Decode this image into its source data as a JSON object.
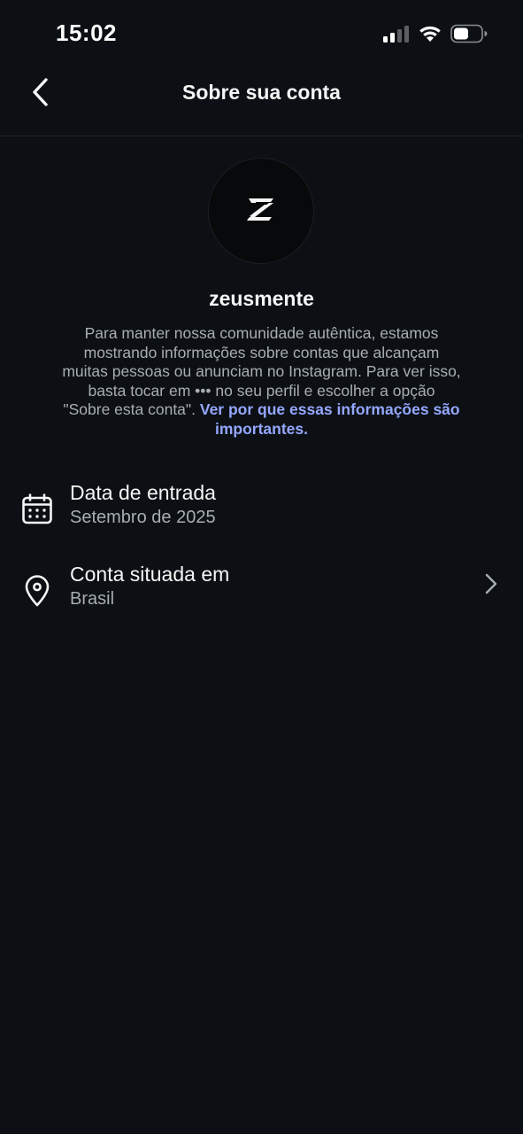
{
  "status_bar": {
    "time": "15:02",
    "icons": [
      "cellular-signal-icon",
      "wifi-icon",
      "battery-icon"
    ]
  },
  "header": {
    "title": "Sobre sua conta",
    "back_icon": "chevron-left-icon"
  },
  "profile": {
    "username": "zeusmente",
    "avatar_glyph": "Z"
  },
  "description": {
    "text_lines": [
      "Para manter nossa comunidade autêntica, estamos",
      "mostrando informações sobre contas que alcançam",
      "muitas pessoas ou anunciam no Instagram. Para ver isso,",
      "basta tocar em ••• no seu perfil e escolher a opção",
      "\"Sobre esta conta\". "
    ],
    "link_line_1": "Ver por que essas informações são",
    "link_line_2": "importantes."
  },
  "info_rows": [
    {
      "title": "Data de entrada",
      "value": "Setembro de 2025",
      "icon": "calendar-icon"
    },
    {
      "title": "Conta situada em",
      "value": "Brasil",
      "icon": "location-pin-icon",
      "has_chevron": true
    }
  ],
  "colors": {
    "background": "#0c1014",
    "link": "#95a7ff",
    "secondary_text": "#a8adb4",
    "primary_text": "#f5f5f5"
  }
}
